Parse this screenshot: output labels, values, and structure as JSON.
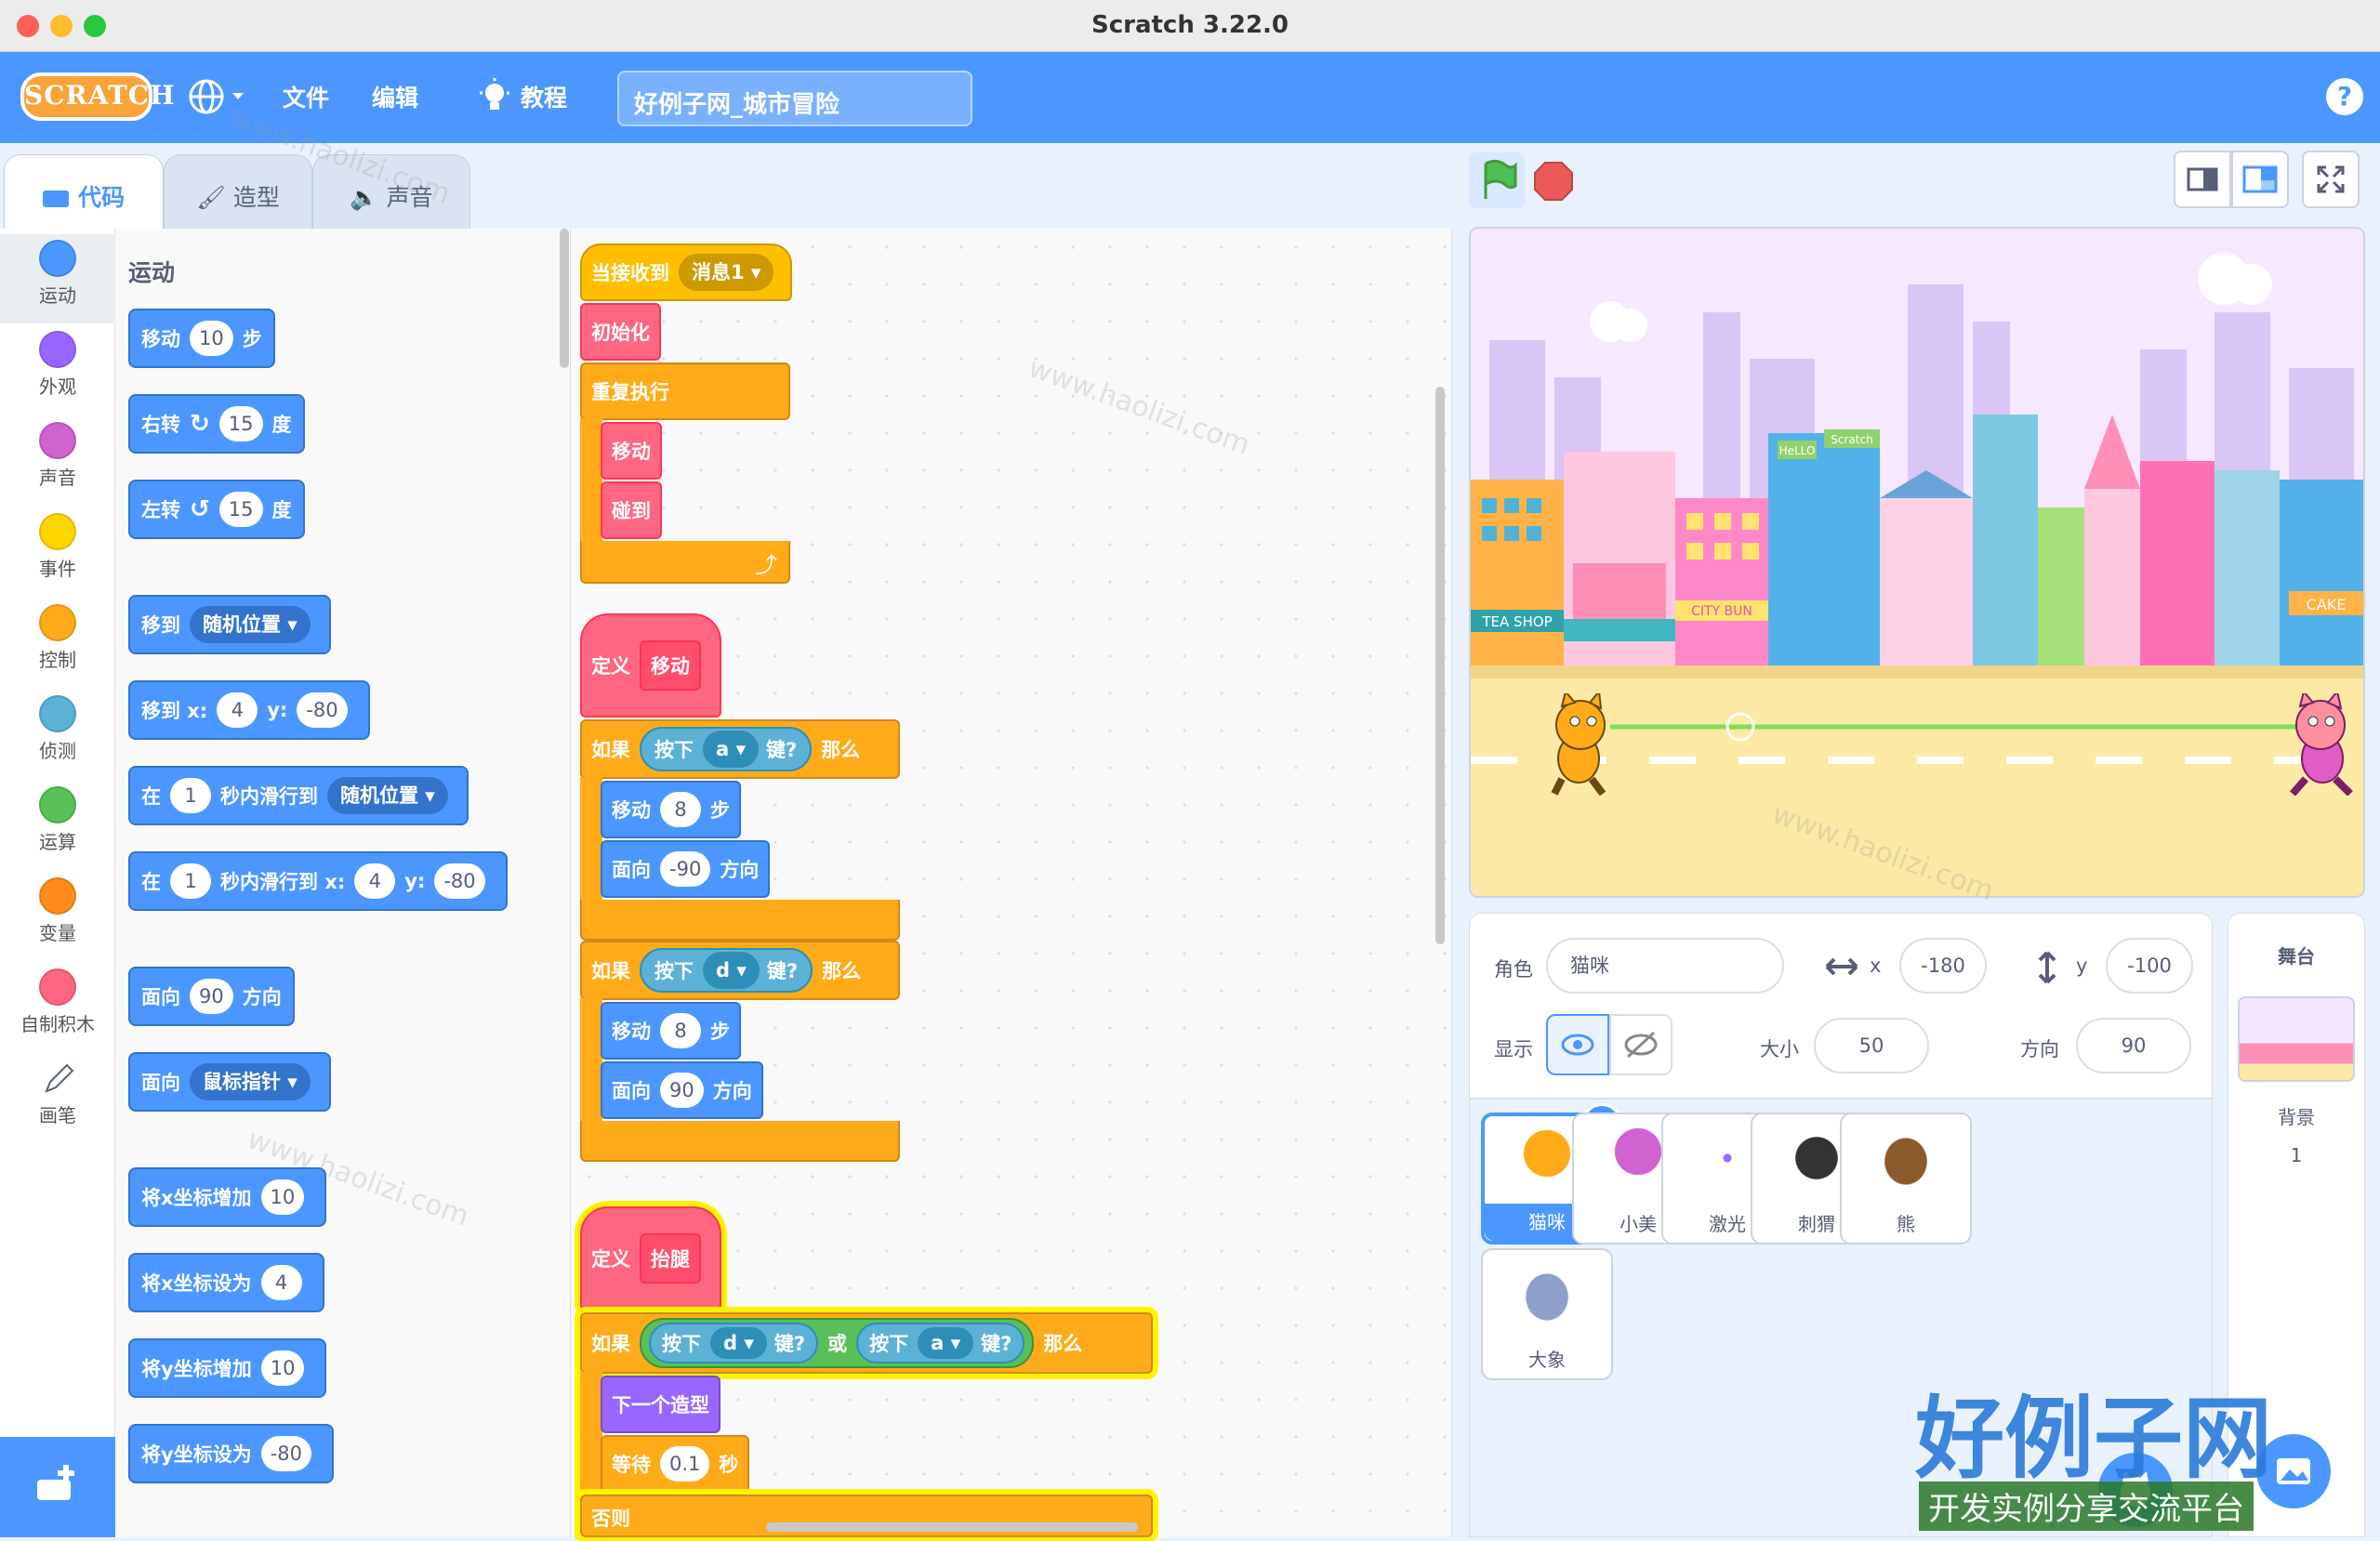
{
  "window": {
    "title": "Scratch 3.22.0"
  },
  "menu": {
    "logo": "SCRATCH",
    "file": "文件",
    "edit": "编辑",
    "tutorials": "教程",
    "project_title": "好例子网_城市冒险",
    "help": "?"
  },
  "tabs": [
    {
      "label": "代码"
    },
    {
      "label": "造型"
    },
    {
      "label": "声音"
    }
  ],
  "categories": [
    {
      "label": "运动",
      "color": "#4c97ff"
    },
    {
      "label": "外观",
      "color": "#9966ff"
    },
    {
      "label": "声音",
      "color": "#cf63cf"
    },
    {
      "label": "事件",
      "color": "#ffd500"
    },
    {
      "label": "控制",
      "color": "#ffab19"
    },
    {
      "label": "侦测",
      "color": "#5cb1d6"
    },
    {
      "label": "运算",
      "color": "#59c059"
    },
    {
      "label": "变量",
      "color": "#ff8c1a"
    },
    {
      "label": "自制积木",
      "color": "#ff6680"
    },
    {
      "label": "画笔",
      "color": "#0fbd8c"
    }
  ],
  "palette": {
    "title": "运动",
    "move": {
      "a": "移动",
      "v": "10",
      "b": "步"
    },
    "turn_right": {
      "a": "右转",
      "v": "15",
      "b": "度"
    },
    "turn_left": {
      "a": "左转",
      "v": "15",
      "b": "度"
    },
    "goto": {
      "a": "移到",
      "d": "随机位置"
    },
    "goto_xy": {
      "a": "移到 x:",
      "x": "4",
      "b": "y:",
      "y": "-80"
    },
    "glide": {
      "a": "在",
      "v": "1",
      "b": "秒内滑行到",
      "d": "随机位置"
    },
    "glide_xy": {
      "a": "在",
      "v": "1",
      "b": "秒内滑行到 x:",
      "x": "4",
      "c": "y:",
      "y": "-80"
    },
    "point_dir": {
      "a": "面向",
      "v": "90",
      "b": "方向"
    },
    "point_toward": {
      "a": "面向",
      "d": "鼠标指针"
    },
    "change_x": {
      "a": "将x坐标增加",
      "v": "10"
    },
    "set_x": {
      "a": "将x坐标设为",
      "v": "4"
    },
    "change_y": {
      "a": "将y坐标增加",
      "v": "10"
    },
    "set_y": {
      "a": "将y坐标设为",
      "v": "-80"
    }
  },
  "script": {
    "when_receive": "当接收到",
    "message": "消息1",
    "init": "初始化",
    "forever": "重复执行",
    "call_move": "移动",
    "call_hit": "碰到",
    "define": "定义",
    "def_move": "移动",
    "if": "如果",
    "then": "那么",
    "key_press": "按下",
    "key_suffix": "键?",
    "key_a": "a",
    "key_d": "d",
    "move": "移动",
    "steps": "步",
    "n8": "8",
    "face": "面向",
    "dir": "方向",
    "dir_neg90": "-90",
    "dir_90": "90",
    "def_leg": "抬腿",
    "or": "或",
    "next_costume": "下一个造型",
    "wait": "等待",
    "wait_v": "0.1",
    "sec": "秒",
    "else": "否则"
  },
  "zoom": {
    "in": "+",
    "out": "−",
    "reset": "="
  },
  "sprite_info": {
    "sprite_label": "角色",
    "sprite_name": "猫咪",
    "x_label": "x",
    "x": "-180",
    "y_label": "y",
    "y": "-100",
    "show_label": "显示",
    "size_label": "大小",
    "size": "50",
    "direction_label": "方向",
    "direction": "90"
  },
  "sprites": [
    {
      "name": "猫咪",
      "color": "#ffab19"
    },
    {
      "name": "小美",
      "color": "#cf63cf"
    },
    {
      "name": "激光",
      "color": "#9966ff"
    },
    {
      "name": "刺猬",
      "color": "#333333"
    },
    {
      "name": "熊",
      "color": "#8b5a2b"
    },
    {
      "name": "大象",
      "color": "#8ea0c9"
    }
  ],
  "stage_pane": {
    "title": "舞台",
    "backdrop_label": "背景",
    "backdrop_count": "1"
  },
  "stage": {
    "sign_tea": "TEA SHOP",
    "sign_bun": "CITY BUN",
    "sign_cake": "CAKE",
    "sign_scratch": "Scratch",
    "sign_hello": "HeLLO"
  },
  "watermark": {
    "site": "www.haolizi.com",
    "brand": "好例子网",
    "slogan": "开发实例分享交流平台"
  }
}
